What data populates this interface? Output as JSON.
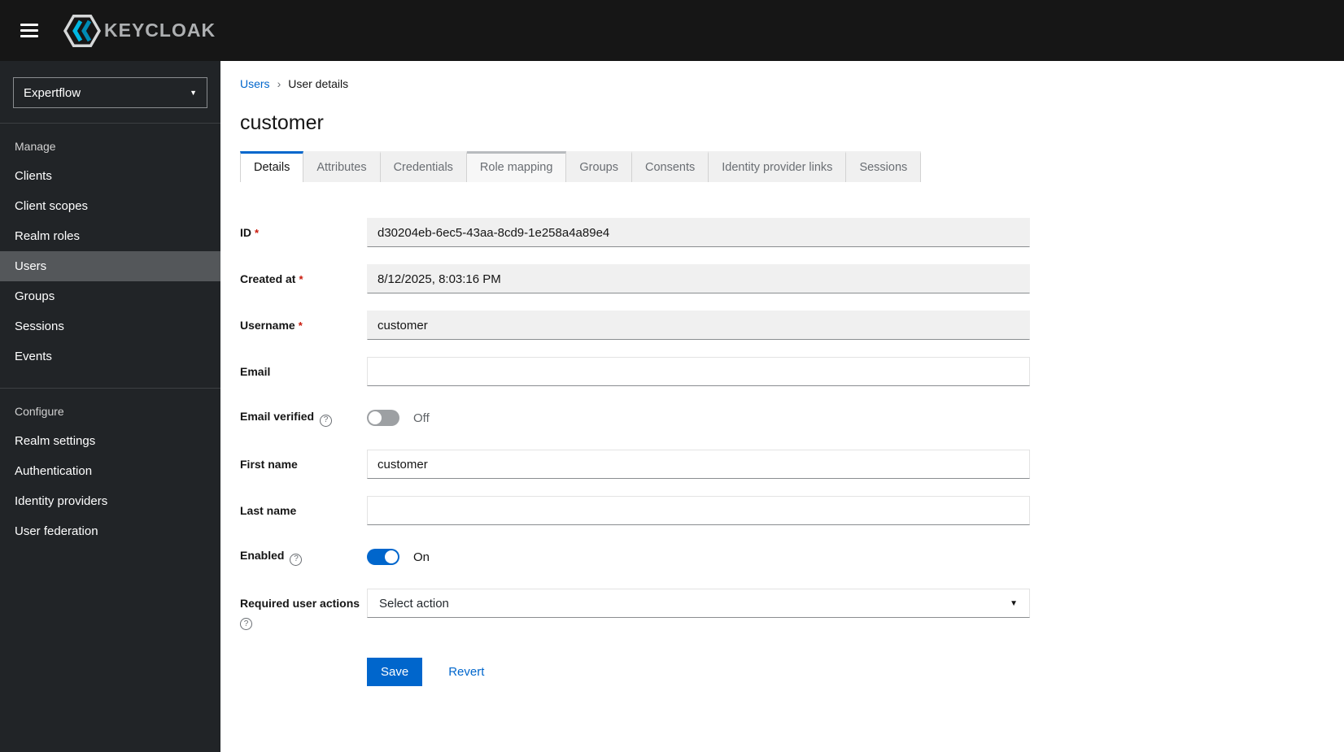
{
  "topbar": {
    "brand": "KEYCLOAK"
  },
  "icons": {
    "caret_down": "▼",
    "help": "?",
    "breadcrumb_divider": "›",
    "required": "*"
  },
  "sidebar": {
    "realm": "Expertflow",
    "manage": {
      "title": "Manage",
      "items": [
        "Clients",
        "Client scopes",
        "Realm roles",
        "Users",
        "Groups",
        "Sessions",
        "Events"
      ]
    },
    "configure": {
      "title": "Configure",
      "items": [
        "Realm settings",
        "Authentication",
        "Identity providers",
        "User federation"
      ]
    },
    "active_item": "Users"
  },
  "breadcrumb": {
    "parent": "Users",
    "current": "User details"
  },
  "page_title": "customer",
  "tabs": [
    "Details",
    "Attributes",
    "Credentials",
    "Role mapping",
    "Groups",
    "Consents",
    "Identity provider links",
    "Sessions"
  ],
  "active_tab": "Details",
  "form": {
    "id": {
      "label": "ID",
      "value": "d30204eb-6ec5-43aa-8cd9-1e258a4a89e4"
    },
    "created_at": {
      "label": "Created at",
      "value": "8/12/2025, 8:03:16 PM"
    },
    "username": {
      "label": "Username",
      "value": "customer"
    },
    "email": {
      "label": "Email",
      "value": ""
    },
    "email_verified": {
      "label": "Email verified",
      "state": "Off"
    },
    "first_name": {
      "label": "First name",
      "value": "customer"
    },
    "last_name": {
      "label": "Last name",
      "value": ""
    },
    "enabled": {
      "label": "Enabled",
      "state": "On"
    },
    "required_user_actions": {
      "label": "Required user actions",
      "placeholder": "Select action"
    }
  },
  "actions": {
    "save": "Save",
    "revert": "Revert"
  }
}
